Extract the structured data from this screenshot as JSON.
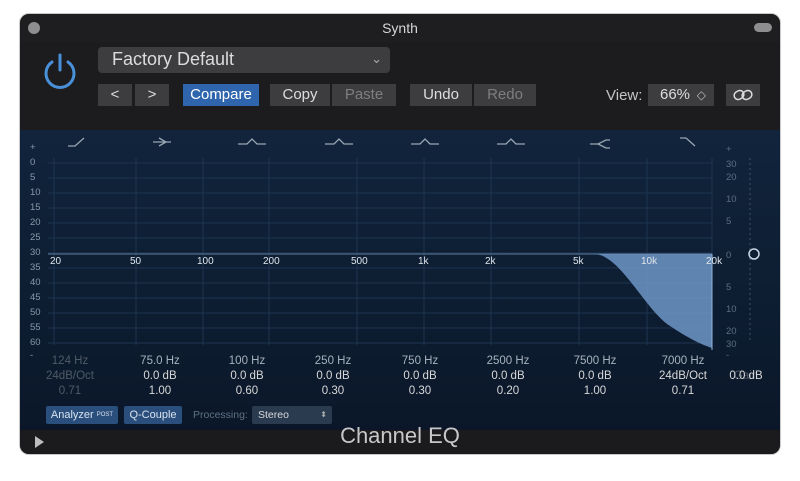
{
  "window": {
    "title": "Synth"
  },
  "header": {
    "preset": "Factory Default",
    "prev_label": "<",
    "next_label": ">",
    "compare_label": "Compare",
    "copy_label": "Copy",
    "paste_label": "Paste",
    "undo_label": "Undo",
    "redo_label": "Redo",
    "view_label": "View:",
    "view_value": "66%"
  },
  "graph": {
    "db_scale_left": [
      "+",
      "0",
      "5",
      "10",
      "15",
      "20",
      "25",
      "30",
      "35",
      "40",
      "45",
      "50",
      "55",
      "60",
      "-"
    ],
    "gain_scale_right": [
      "+",
      "30",
      "20",
      "10",
      "5",
      "0",
      "5",
      "10",
      "20",
      "30",
      "-"
    ],
    "freq_labels": [
      "20",
      "50",
      "100",
      "200",
      "500",
      "1k",
      "2k",
      "5k",
      "10k",
      "20k"
    ]
  },
  "bands": [
    {
      "freq": "124 Hz",
      "gain": "24dB/Oct",
      "q": "0.71",
      "enabled": false
    },
    {
      "freq": "75.0 Hz",
      "gain": "0.0 dB",
      "q": "1.00",
      "enabled": true
    },
    {
      "freq": "100 Hz",
      "gain": "0.0 dB",
      "q": "0.60",
      "enabled": true
    },
    {
      "freq": "250 Hz",
      "gain": "0.0 dB",
      "q": "0.30",
      "enabled": true
    },
    {
      "freq": "750 Hz",
      "gain": "0.0 dB",
      "q": "0.30",
      "enabled": true
    },
    {
      "freq": "2500 Hz",
      "gain": "0.0 dB",
      "q": "0.20",
      "enabled": true
    },
    {
      "freq": "7500 Hz",
      "gain": "0.0 dB",
      "q": "1.00",
      "enabled": true
    },
    {
      "freq": "7000 Hz",
      "gain": "24dB/Oct",
      "q": "0.71",
      "enabled": true
    }
  ],
  "gain_control": {
    "label": "Gain",
    "value": "0.0 dB"
  },
  "controls": {
    "analyzer_label": "Analyzer",
    "analyzer_badge": "POST",
    "qcouple_label": "Q-Couple",
    "processing_label": "Processing:",
    "processing_value": "Stereo"
  },
  "footer": {
    "plugin_name": "Channel EQ"
  },
  "colors": {
    "accent": "#2f65ac",
    "curve_fill": "#6f97c7"
  }
}
